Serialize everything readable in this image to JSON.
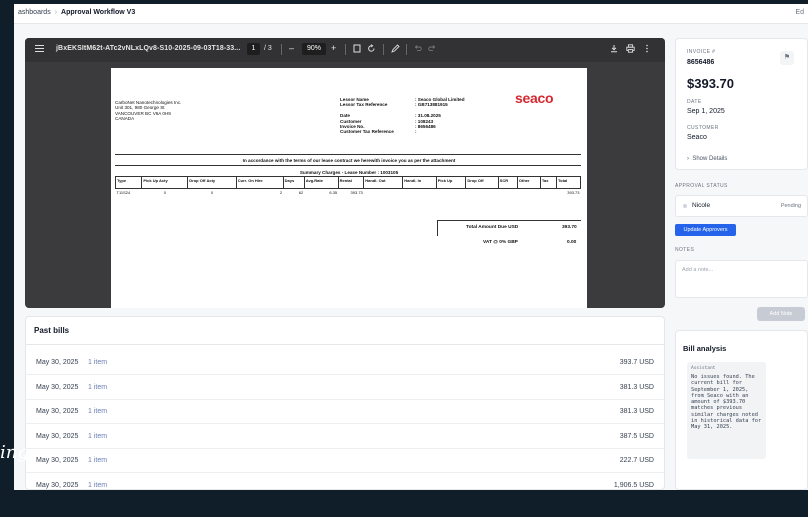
{
  "topbar": {
    "breadcrumb_root": "ashboards",
    "breadcrumb_separator": "›",
    "breadcrumb_current": "Approval Workflow V3",
    "right_text": "Ed"
  },
  "viewer": {
    "file_name": "jBxEKSItM62t-ATc2vNLxLQv8-S10-2025-09-03T18-33...",
    "page_current": "1",
    "page_total": "/ 3",
    "zoom_minus": "–",
    "zoom_level": "90%",
    "zoom_plus": "+",
    "icons": [
      "menu-icon",
      "fit-page-icon",
      "rotate-icon",
      "annotate-icon",
      "undo-icon",
      "redo-icon",
      "download-icon",
      "print-icon",
      "more-options-icon"
    ]
  },
  "invoice_doc": {
    "logo_text": "seaco",
    "sender": [
      "CarboNet Nanotechnologies Inc.",
      "Unit 301, 980 George St",
      "VANCOUVER BC  V6A 0H9",
      "CANADA"
    ],
    "lessor_name_label": "Lessor Name",
    "lessor_name": ": Seaco Global Limited",
    "lessor_tax_label": "Lessor Tax Reference",
    "lessor_tax": ": GB713881915",
    "date_label": "Date",
    "date": ": 31.08.2025",
    "customer_label": "Customer",
    "customer": ": 108243",
    "invoice_no_label": "Invoice No.",
    "invoice_no": ": 8656486",
    "customer_tax_label": "Customer Tax Reference",
    "customer_tax": ":",
    "agreement_text": "In accordance with the terms of our lease contract we herewith invoice you as per the attachment",
    "summary_title": "Summary Charges - Lease Number : 1003105",
    "columns": [
      "Type",
      "Pick Up Acty",
      "Drop Off Acty",
      "Curr. On Hire",
      "Days",
      "Avg.Rate",
      "Rental",
      "Handl. Out",
      "Handl. In",
      "Pick Up",
      "Drop Off",
      "SCR",
      "Other",
      "Tax",
      "Total"
    ],
    "row": [
      "T11S24",
      "0",
      "0",
      "2",
      "62",
      "6.35",
      "393.73",
      "",
      "",
      "",
      "",
      "",
      "",
      "",
      "393.73"
    ],
    "total_label": "Total Amount Due USD",
    "total_value": "393.70",
    "vat_label": "VAT @ 0% GBP",
    "vat_value": "0.00"
  },
  "past_bills": {
    "title": "Past bills",
    "rows": [
      {
        "date": "May 30, 2025",
        "items": "1 item",
        "amount": "393.7 USD"
      },
      {
        "date": "May 30, 2025",
        "items": "1 item",
        "amount": "381.3 USD"
      },
      {
        "date": "May 30, 2025",
        "items": "1 item",
        "amount": "381.3 USD"
      },
      {
        "date": "May 30, 2025",
        "items": "1 item",
        "amount": "387.5 USD"
      },
      {
        "date": "May 30, 2025",
        "items": "1 item",
        "amount": "222.7 USD"
      },
      {
        "date": "May 30, 2025",
        "items": "1 item",
        "amount": "1,906.5 USD"
      }
    ]
  },
  "invoice_panel": {
    "invoice_label": "INVOICE #",
    "invoice_number": "8656486",
    "amount": "$393.70",
    "date_label": "DATE",
    "date": "Sep 1, 2025",
    "customer_label": "CUSTOMER",
    "customer": "Seaco",
    "show_details": "Show Details"
  },
  "approval": {
    "label": "APPROVAL STATUS",
    "approver_name": "Nicole",
    "approver_status": "Pending",
    "update_button": "Update Approvers",
    "notes_label": "NOTES",
    "notes_placeholder": "Add a note...",
    "add_note_button": "Add Note"
  },
  "bill_analysis": {
    "title": "Bill analysis",
    "role": "Assistant",
    "message": "No issues found. The current bill for September 1, 2025, from Seaco with an amount of $393.70 matches previous similar charges noted in historical data for May 31, 2025."
  },
  "overlay": {
    "side_text": "ing"
  }
}
